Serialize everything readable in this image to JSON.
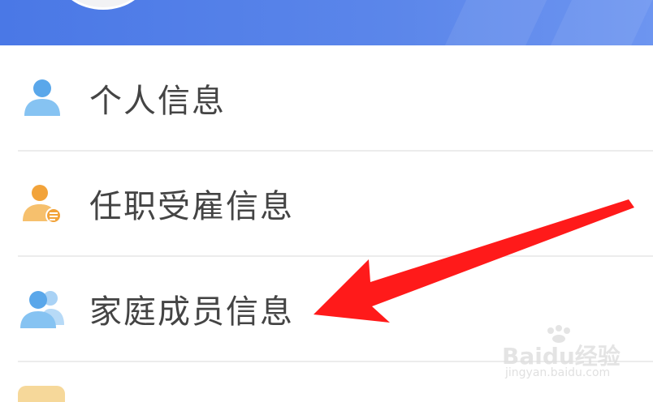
{
  "menu": {
    "items": [
      {
        "label": "个人信息",
        "icon": "person-icon"
      },
      {
        "label": "任职受雇信息",
        "icon": "employee-icon"
      },
      {
        "label": "家庭成员信息",
        "icon": "family-icon"
      }
    ]
  },
  "watermark": {
    "brand": "Baidu经验",
    "sub": "jingyan.baidu.com"
  },
  "colors": {
    "header": "#4a78e6",
    "icon_blue": "#5aa7ea",
    "icon_orange": "#f2a33a",
    "arrow": "#ff1a1a"
  }
}
